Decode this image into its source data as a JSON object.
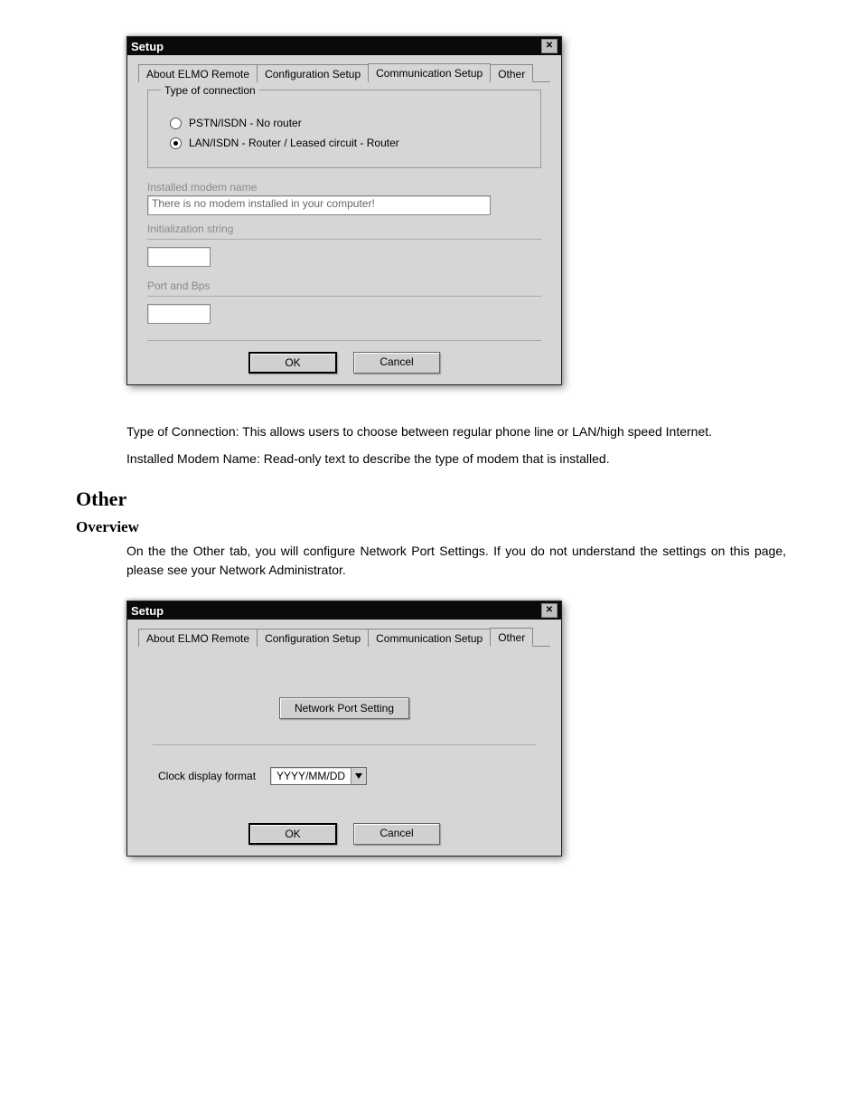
{
  "dialog1": {
    "title": "Setup",
    "tabs": [
      "About ELMO Remote",
      "Configuration Setup",
      "Communication Setup",
      "Other"
    ],
    "activeTab": 2,
    "group": {
      "legend": "Type of connection",
      "opt1": "PSTN/ISDN - No router",
      "opt2": "LAN/ISDN - Router / Leased circuit - Router"
    },
    "modemLabel": "Installed modem name",
    "modemValue": "There is no modem installed in your computer!",
    "initLabel": "Initialization string",
    "portLabel": "Port and Bps",
    "ok": "OK",
    "cancel": "Cancel"
  },
  "desc": {
    "line1": "Type of Connection: This allows users to choose between regular phone line or LAN/high speed Internet.",
    "line2": "Installed Modem Name: Read-only text to describe the type of modem that is installed."
  },
  "sectionOther": {
    "heading": "Other",
    "subheading": "Overview",
    "text": "On the the Other tab, you will configure Network Port Settings. If you do not understand the settings on this page, please see your Network Administrator."
  },
  "dialog2": {
    "title": "Setup",
    "tabs": [
      "About ELMO Remote",
      "Configuration Setup",
      "Communication Setup",
      "Other"
    ],
    "activeTab": 3,
    "netBtn": "Network Port Setting",
    "clockLabel": "Clock display format",
    "clockValue": "YYYY/MM/DD",
    "ok": "OK",
    "cancel": "Cancel"
  }
}
